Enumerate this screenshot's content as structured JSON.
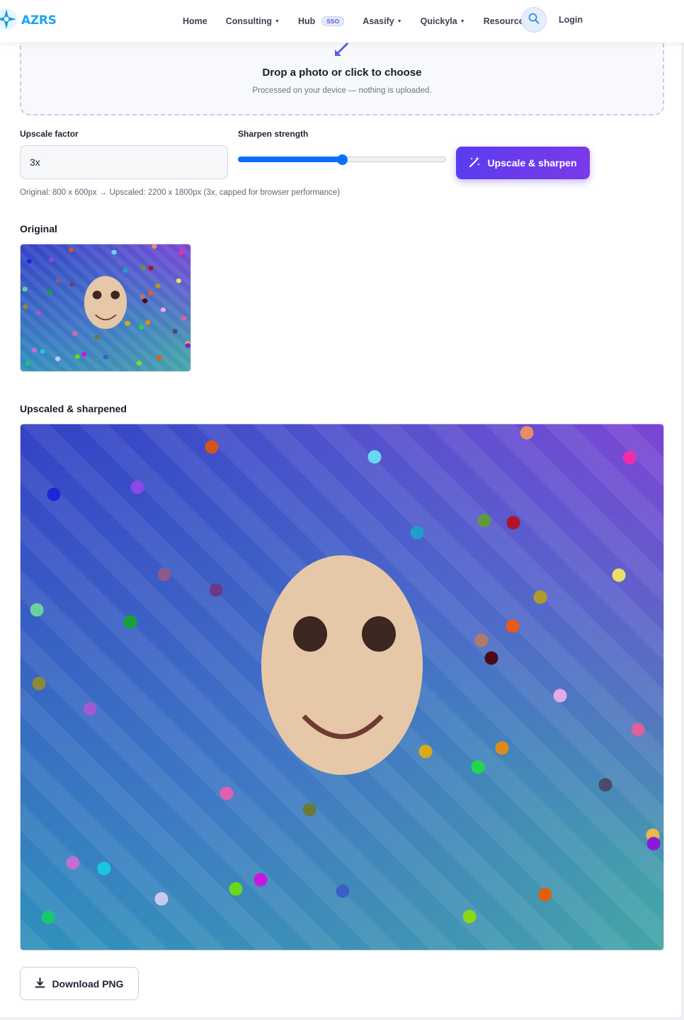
{
  "brand": {
    "name": "AZRS",
    "color": "#20a4e8"
  },
  "nav": {
    "items": [
      {
        "label": "Home",
        "caret": false
      },
      {
        "label": "Consulting",
        "caret": true
      },
      {
        "label": "Hub",
        "caret": false,
        "badge": "SSO"
      },
      {
        "label": "Asasify",
        "caret": true
      },
      {
        "label": "Quickyla",
        "caret": true
      },
      {
        "label": "Resources",
        "caret": true
      }
    ],
    "search_icon": "search-icon",
    "login_label": "Login"
  },
  "dropzone": {
    "icon": "upload-arrow-icon",
    "title": "Drop a photo or click to choose",
    "subtitle": "Processed on your device — nothing is uploaded."
  },
  "controls": {
    "factor_label": "Upscale factor",
    "factor_value": "3x",
    "sharpen_label": "Sharpen strength",
    "sharpen_value": 0.5,
    "action_label": "Upscale & sharpen",
    "action_icon": "magic-wand-icon",
    "accent": "#0d6efd",
    "button_color": "#6a3bed"
  },
  "info": "Original: 800 x 600px → Upscaled: 2200 x 1800px (3x, capped for browser performance)",
  "original": {
    "heading": "Original"
  },
  "upscaled": {
    "heading": "Upscaled & sharpened"
  },
  "download": {
    "label": "Download PNG",
    "icon": "download-icon"
  }
}
